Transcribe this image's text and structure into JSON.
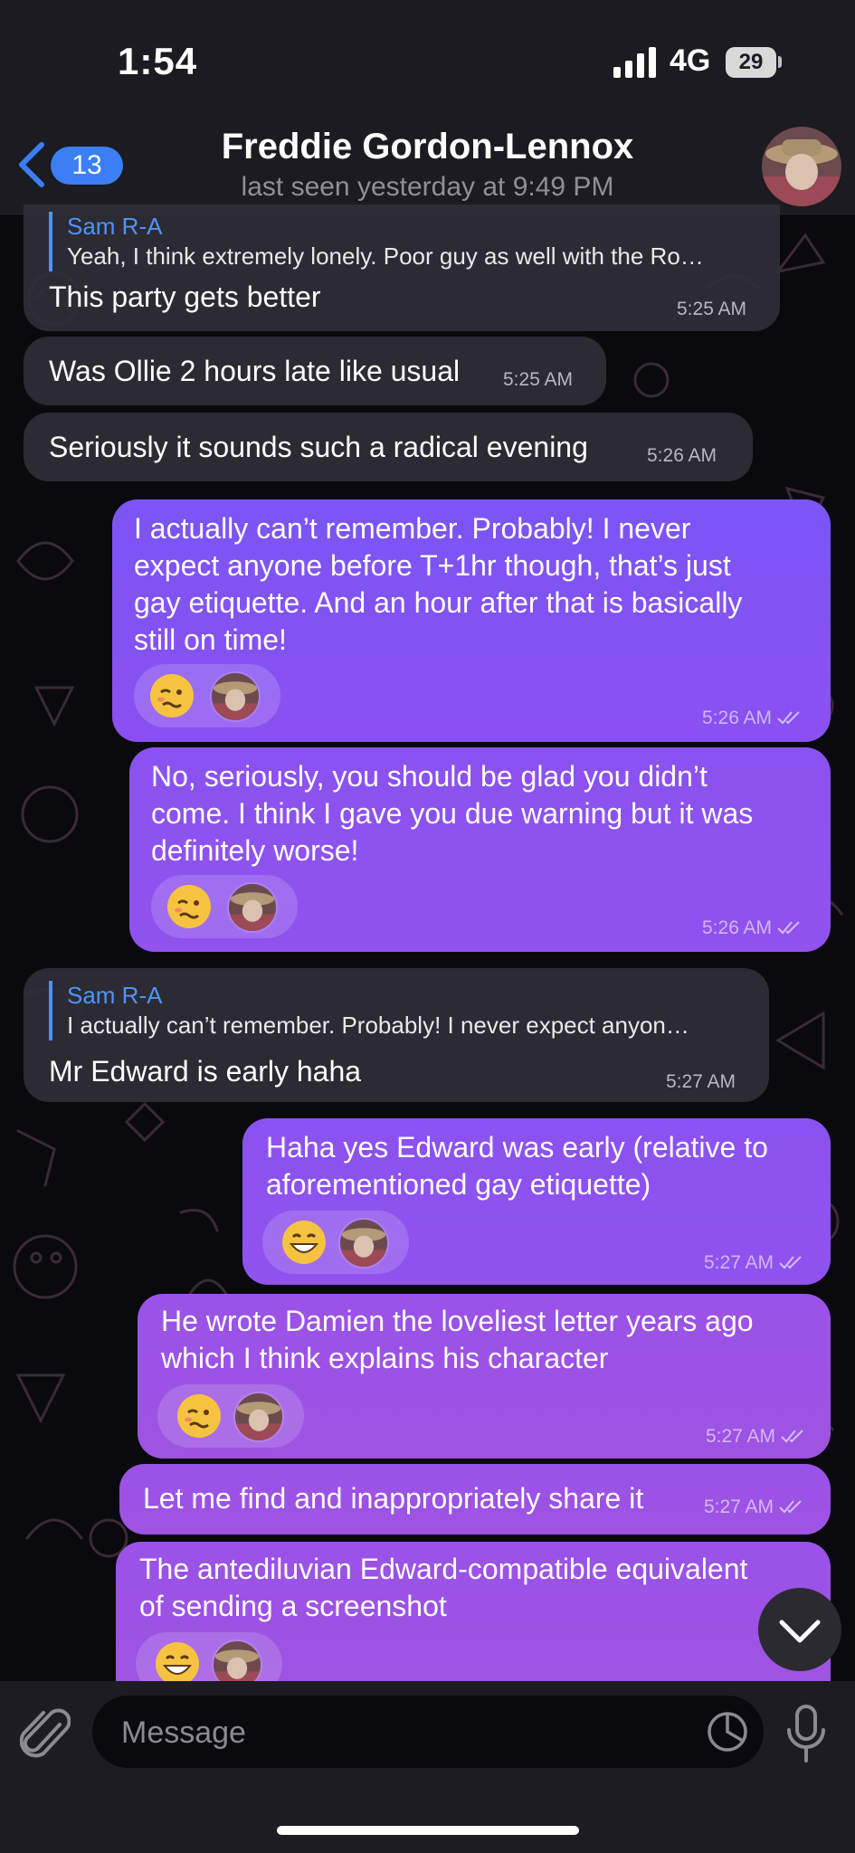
{
  "status": {
    "time": "1:54",
    "network": "4G",
    "battery": "29"
  },
  "header": {
    "back_count": "13",
    "name": "Freddie Gordon-Lennox",
    "last_seen": "last seen yesterday at 9:49 PM"
  },
  "messages": [
    {
      "dir": "in",
      "reply_name": "Sam R-A",
      "reply_text": "Yeah, I think extremely lonely. Poor guy as well with the Ro…",
      "text": "This party gets better",
      "time": "5:25 AM"
    },
    {
      "dir": "in",
      "text": "Was Ollie 2 hours late like usual",
      "time": "5:25 AM"
    },
    {
      "dir": "in",
      "text": "Seriously it sounds such a radical evening",
      "time": "5:26 AM"
    },
    {
      "dir": "out",
      "lines": [
        "I actually can’t remember. Probably! I never",
        "expect anyone before T+1hr though, that’s just",
        "gay etiquette. And an hour after that is basically",
        "still on time!"
      ],
      "time": "5:26 AM",
      "reaction": "woozy-face-emoji"
    },
    {
      "dir": "out",
      "lines": [
        "No, seriously, you should be glad you didn’t",
        "come. I think I gave you due warning but it was",
        "definitely worse!"
      ],
      "time": "5:26 AM",
      "reaction": "woozy-face-emoji"
    },
    {
      "dir": "in",
      "reply_name": "Sam R-A",
      "reply_text": "I actually can’t remember. Probably! I never expect anyon…",
      "text": "Mr Edward is early haha",
      "time": "5:27 AM"
    },
    {
      "dir": "out",
      "lines": [
        "Haha yes Edward was early (relative to",
        "aforementioned gay etiquette)"
      ],
      "time": "5:27 AM",
      "reaction": "grinning-face-emoji"
    },
    {
      "dir": "out",
      "lines": [
        "He wrote Damien the loveliest letter years ago",
        "which I think explains his character"
      ],
      "time": "5:27 AM",
      "reaction": "woozy-face-emoji"
    },
    {
      "dir": "out",
      "text": "Let me find and inappropriately share it",
      "time": "5:27 AM"
    },
    {
      "dir": "out",
      "lines": [
        "The antediluvian Edward-compatible equivalent",
        "of sending a screenshot"
      ],
      "reaction": "grinning-face-emoji"
    }
  ],
  "composer": {
    "placeholder": "Message"
  }
}
